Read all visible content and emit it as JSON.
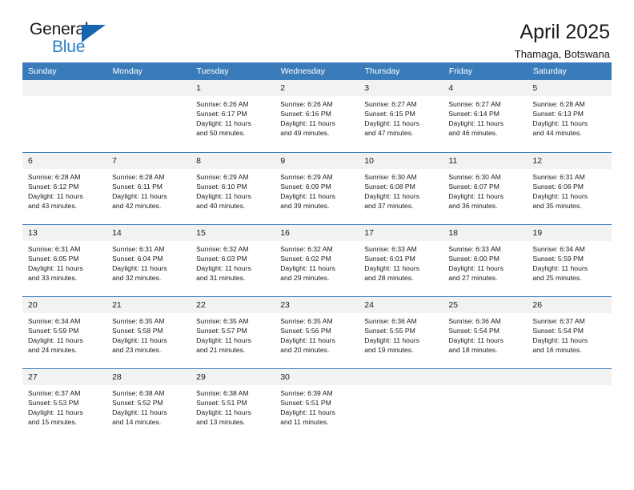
{
  "brand": {
    "name_top": "General",
    "name_bottom": "Blue",
    "accent_color": "#2a7fc9",
    "triangle_color": "#1565b0"
  },
  "header": {
    "title": "April 2025",
    "subtitle": "Thamaga, Botswana"
  },
  "theme": {
    "header_bg": "#3a7cba",
    "daynum_bg": "#f2f2f2",
    "text_color": "#1a1a1a"
  },
  "weekday_headers": [
    "Sunday",
    "Monday",
    "Tuesday",
    "Wednesday",
    "Thursday",
    "Friday",
    "Saturday"
  ],
  "labels": {
    "sunrise": "Sunrise:",
    "sunset": "Sunset:",
    "daylight": "Daylight:"
  },
  "weeks": [
    [
      {
        "day": "",
        "empty": true
      },
      {
        "day": "",
        "empty": true
      },
      {
        "day": "1",
        "sunrise": "Sunrise: 6:26 AM",
        "sunset": "Sunset: 6:17 PM",
        "daylight_1": "Daylight: 11 hours",
        "daylight_2": "and 50 minutes."
      },
      {
        "day": "2",
        "sunrise": "Sunrise: 6:26 AM",
        "sunset": "Sunset: 6:16 PM",
        "daylight_1": "Daylight: 11 hours",
        "daylight_2": "and 49 minutes."
      },
      {
        "day": "3",
        "sunrise": "Sunrise: 6:27 AM",
        "sunset": "Sunset: 6:15 PM",
        "daylight_1": "Daylight: 11 hours",
        "daylight_2": "and 47 minutes."
      },
      {
        "day": "4",
        "sunrise": "Sunrise: 6:27 AM",
        "sunset": "Sunset: 6:14 PM",
        "daylight_1": "Daylight: 11 hours",
        "daylight_2": "and 46 minutes."
      },
      {
        "day": "5",
        "sunrise": "Sunrise: 6:28 AM",
        "sunset": "Sunset: 6:13 PM",
        "daylight_1": "Daylight: 11 hours",
        "daylight_2": "and 44 minutes."
      }
    ],
    [
      {
        "day": "6",
        "sunrise": "Sunrise: 6:28 AM",
        "sunset": "Sunset: 6:12 PM",
        "daylight_1": "Daylight: 11 hours",
        "daylight_2": "and 43 minutes."
      },
      {
        "day": "7",
        "sunrise": "Sunrise: 6:28 AM",
        "sunset": "Sunset: 6:11 PM",
        "daylight_1": "Daylight: 11 hours",
        "daylight_2": "and 42 minutes."
      },
      {
        "day": "8",
        "sunrise": "Sunrise: 6:29 AM",
        "sunset": "Sunset: 6:10 PM",
        "daylight_1": "Daylight: 11 hours",
        "daylight_2": "and 40 minutes."
      },
      {
        "day": "9",
        "sunrise": "Sunrise: 6:29 AM",
        "sunset": "Sunset: 6:09 PM",
        "daylight_1": "Daylight: 11 hours",
        "daylight_2": "and 39 minutes."
      },
      {
        "day": "10",
        "sunrise": "Sunrise: 6:30 AM",
        "sunset": "Sunset: 6:08 PM",
        "daylight_1": "Daylight: 11 hours",
        "daylight_2": "and 37 minutes."
      },
      {
        "day": "11",
        "sunrise": "Sunrise: 6:30 AM",
        "sunset": "Sunset: 6:07 PM",
        "daylight_1": "Daylight: 11 hours",
        "daylight_2": "and 36 minutes."
      },
      {
        "day": "12",
        "sunrise": "Sunrise: 6:31 AM",
        "sunset": "Sunset: 6:06 PM",
        "daylight_1": "Daylight: 11 hours",
        "daylight_2": "and 35 minutes."
      }
    ],
    [
      {
        "day": "13",
        "sunrise": "Sunrise: 6:31 AM",
        "sunset": "Sunset: 6:05 PM",
        "daylight_1": "Daylight: 11 hours",
        "daylight_2": "and 33 minutes."
      },
      {
        "day": "14",
        "sunrise": "Sunrise: 6:31 AM",
        "sunset": "Sunset: 6:04 PM",
        "daylight_1": "Daylight: 11 hours",
        "daylight_2": "and 32 minutes."
      },
      {
        "day": "15",
        "sunrise": "Sunrise: 6:32 AM",
        "sunset": "Sunset: 6:03 PM",
        "daylight_1": "Daylight: 11 hours",
        "daylight_2": "and 31 minutes."
      },
      {
        "day": "16",
        "sunrise": "Sunrise: 6:32 AM",
        "sunset": "Sunset: 6:02 PM",
        "daylight_1": "Daylight: 11 hours",
        "daylight_2": "and 29 minutes."
      },
      {
        "day": "17",
        "sunrise": "Sunrise: 6:33 AM",
        "sunset": "Sunset: 6:01 PM",
        "daylight_1": "Daylight: 11 hours",
        "daylight_2": "and 28 minutes."
      },
      {
        "day": "18",
        "sunrise": "Sunrise: 6:33 AM",
        "sunset": "Sunset: 6:00 PM",
        "daylight_1": "Daylight: 11 hours",
        "daylight_2": "and 27 minutes."
      },
      {
        "day": "19",
        "sunrise": "Sunrise: 6:34 AM",
        "sunset": "Sunset: 5:59 PM",
        "daylight_1": "Daylight: 11 hours",
        "daylight_2": "and 25 minutes."
      }
    ],
    [
      {
        "day": "20",
        "sunrise": "Sunrise: 6:34 AM",
        "sunset": "Sunset: 5:59 PM",
        "daylight_1": "Daylight: 11 hours",
        "daylight_2": "and 24 minutes."
      },
      {
        "day": "21",
        "sunrise": "Sunrise: 6:35 AM",
        "sunset": "Sunset: 5:58 PM",
        "daylight_1": "Daylight: 11 hours",
        "daylight_2": "and 23 minutes."
      },
      {
        "day": "22",
        "sunrise": "Sunrise: 6:35 AM",
        "sunset": "Sunset: 5:57 PM",
        "daylight_1": "Daylight: 11 hours",
        "daylight_2": "and 21 minutes."
      },
      {
        "day": "23",
        "sunrise": "Sunrise: 6:35 AM",
        "sunset": "Sunset: 5:56 PM",
        "daylight_1": "Daylight: 11 hours",
        "daylight_2": "and 20 minutes."
      },
      {
        "day": "24",
        "sunrise": "Sunrise: 6:36 AM",
        "sunset": "Sunset: 5:55 PM",
        "daylight_1": "Daylight: 11 hours",
        "daylight_2": "and 19 minutes."
      },
      {
        "day": "25",
        "sunrise": "Sunrise: 6:36 AM",
        "sunset": "Sunset: 5:54 PM",
        "daylight_1": "Daylight: 11 hours",
        "daylight_2": "and 18 minutes."
      },
      {
        "day": "26",
        "sunrise": "Sunrise: 6:37 AM",
        "sunset": "Sunset: 5:54 PM",
        "daylight_1": "Daylight: 11 hours",
        "daylight_2": "and 16 minutes."
      }
    ],
    [
      {
        "day": "27",
        "sunrise": "Sunrise: 6:37 AM",
        "sunset": "Sunset: 5:53 PM",
        "daylight_1": "Daylight: 11 hours",
        "daylight_2": "and 15 minutes."
      },
      {
        "day": "28",
        "sunrise": "Sunrise: 6:38 AM",
        "sunset": "Sunset: 5:52 PM",
        "daylight_1": "Daylight: 11 hours",
        "daylight_2": "and 14 minutes."
      },
      {
        "day": "29",
        "sunrise": "Sunrise: 6:38 AM",
        "sunset": "Sunset: 5:51 PM",
        "daylight_1": "Daylight: 11 hours",
        "daylight_2": "and 13 minutes."
      },
      {
        "day": "30",
        "sunrise": "Sunrise: 6:39 AM",
        "sunset": "Sunset: 5:51 PM",
        "daylight_1": "Daylight: 11 hours",
        "daylight_2": "and 11 minutes."
      },
      {
        "day": "",
        "empty": true
      },
      {
        "day": "",
        "empty": true
      },
      {
        "day": "",
        "empty": true
      }
    ]
  ]
}
